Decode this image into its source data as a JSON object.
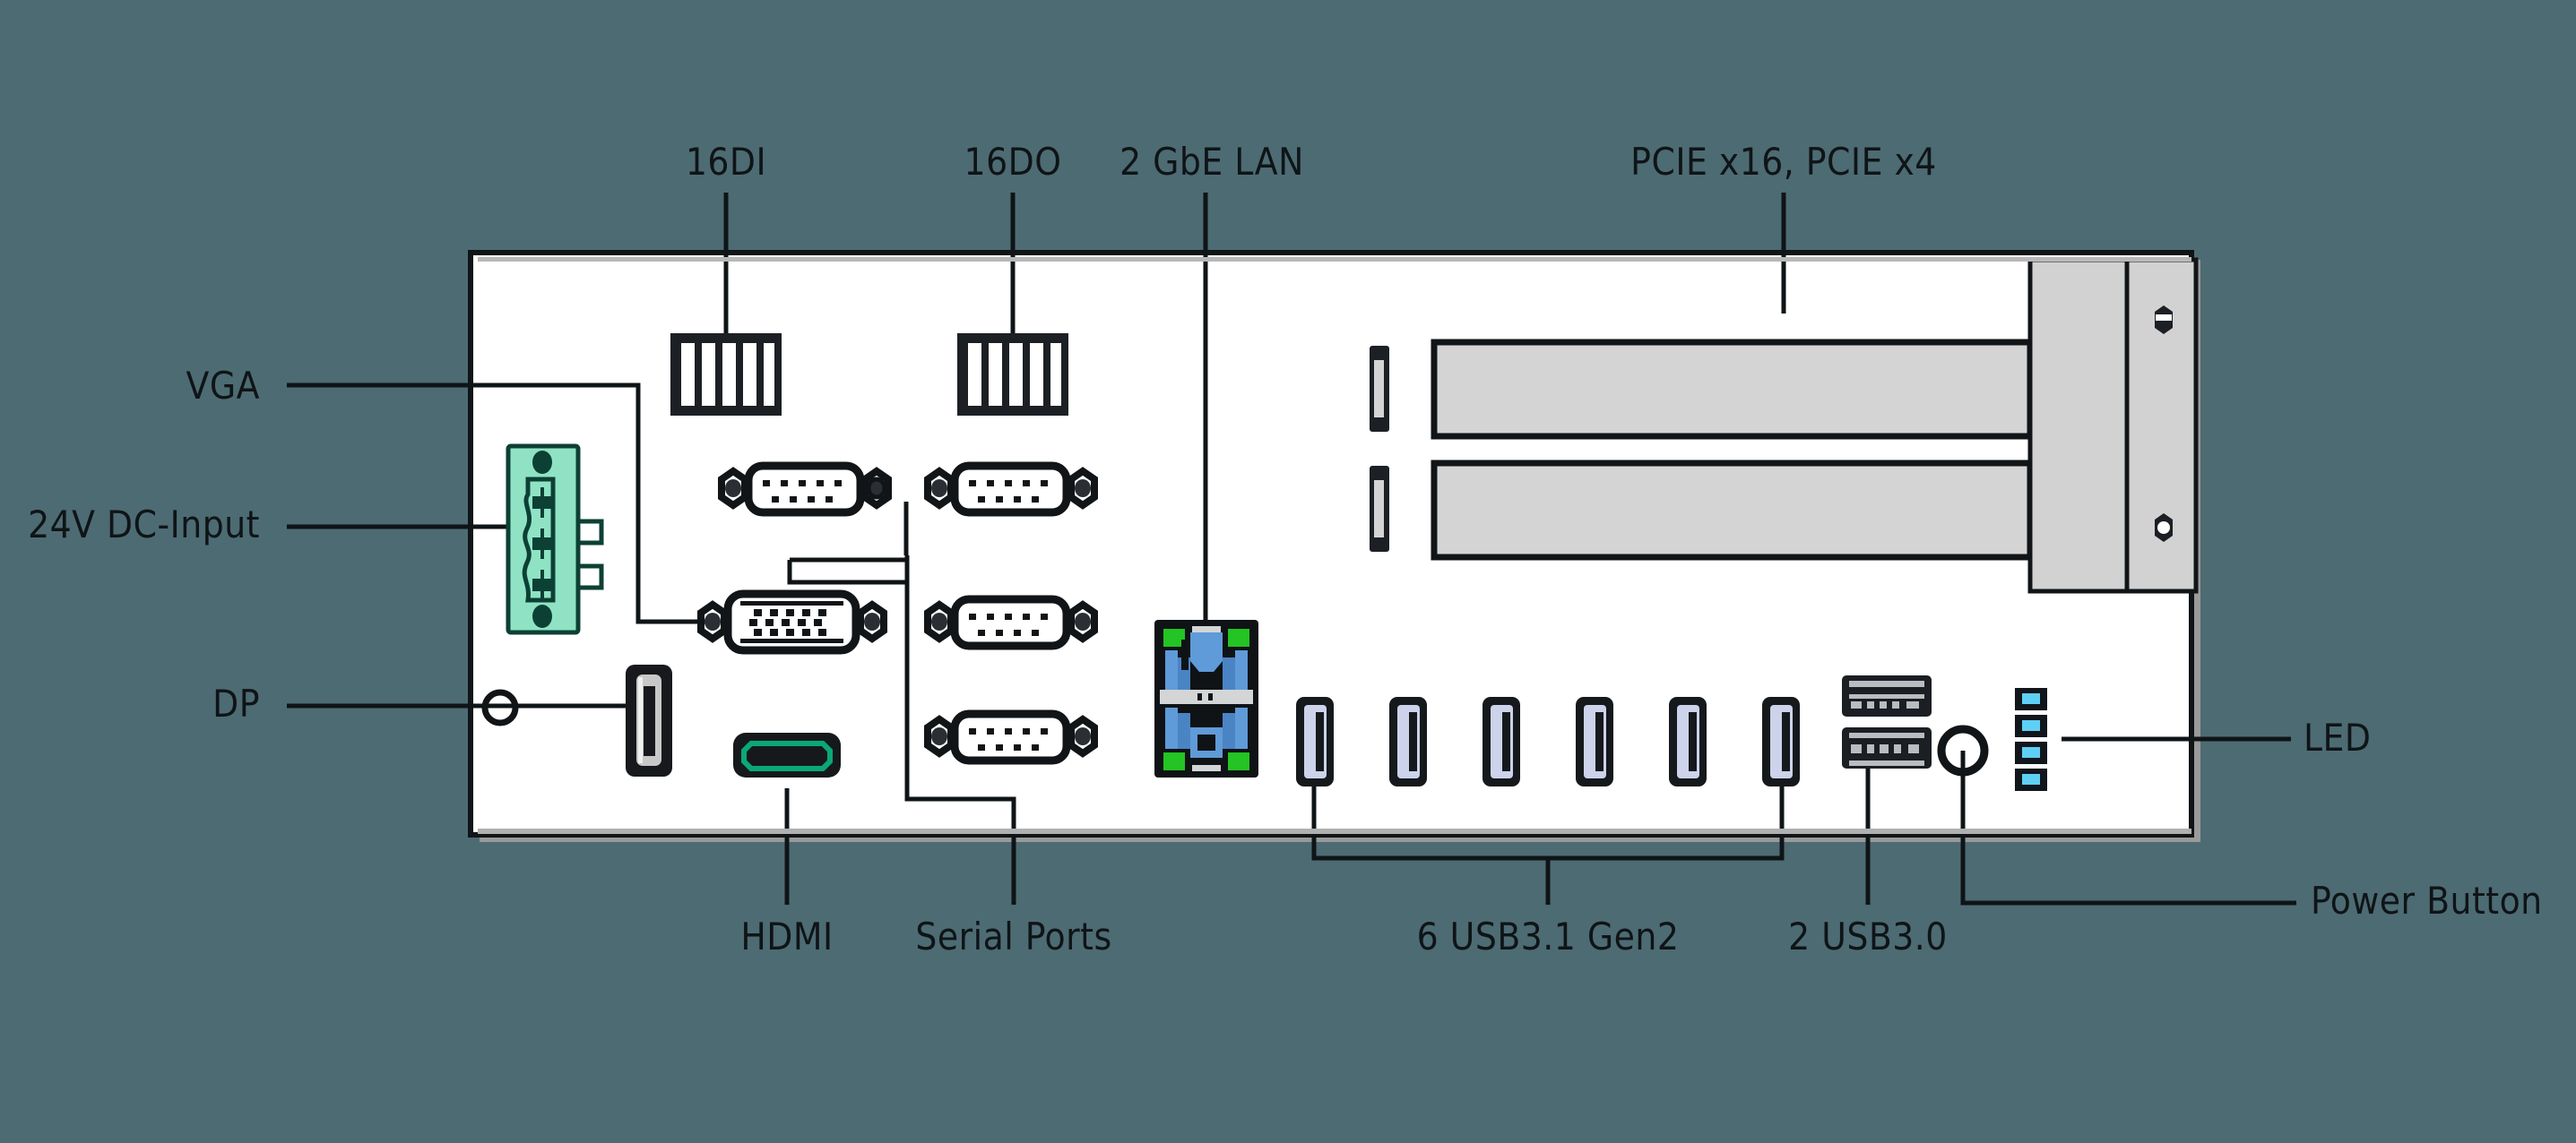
{
  "diagram": {
    "title": "Rear I/O Panel",
    "background_color": "#4d6b73",
    "panel_color": "#ffffff",
    "accent_green": "#8fe3c4",
    "hdmi_green": "#0aa877",
    "usb_blue": "#ccd3ea",
    "lan_led_green": "#23c423",
    "led_cyan": "#5fd0f5"
  },
  "labels": {
    "top": [
      {
        "id": "di",
        "text": "16DI"
      },
      {
        "id": "do",
        "text": "16DO"
      },
      {
        "id": "lan",
        "text": "2 GbE LAN"
      },
      {
        "id": "pcie",
        "text": "PCIE x16,  PCIE x4"
      }
    ],
    "left": [
      {
        "id": "vga",
        "text": "VGA"
      },
      {
        "id": "dc",
        "text": "24V DC-Input"
      },
      {
        "id": "dp",
        "text": "DP"
      }
    ],
    "bottom": [
      {
        "id": "hdmi",
        "text": "HDMI"
      },
      {
        "id": "serial",
        "text": "Serial Ports"
      },
      {
        "id": "usb31",
        "text": "6 USB3.1 Gen2"
      },
      {
        "id": "usb30",
        "text": "2 USB3.0"
      }
    ],
    "right": [
      {
        "id": "led",
        "text": "LED"
      },
      {
        "id": "power",
        "text": "Power Button"
      }
    ]
  },
  "components": {
    "digital_input_block": {
      "name": "16DI terminal block",
      "slots": 5
    },
    "digital_output_block": {
      "name": "16DO terminal block",
      "slots": 5
    },
    "serial_ports": {
      "name": "DB9 serial ports",
      "count": 4,
      "pins": 9
    },
    "vga_port": {
      "name": "VGA DB15",
      "pins": 15
    },
    "dc_input": {
      "name": "24V DC terminal block",
      "terminals": 3
    },
    "display_port": {
      "name": "DisplayPort"
    },
    "hdmi_port": {
      "name": "HDMI"
    },
    "lan_ports": {
      "name": "2 GbE LAN RJ45 stacked",
      "count": 2
    },
    "usb31_ports": {
      "name": "USB 3.1 Gen2 Type-A",
      "count": 6
    },
    "usb30_ports": {
      "name": "USB 3.0 Type-A",
      "count": 2
    },
    "led_indicators": {
      "name": "LED indicators",
      "count": 4
    },
    "power_button": {
      "name": "Power Button"
    },
    "pcie_slots": {
      "name": "PCIE expansion slots",
      "count": 2
    },
    "thumb_screws": {
      "name": "Bracket thumb screws",
      "count": 2
    }
  }
}
